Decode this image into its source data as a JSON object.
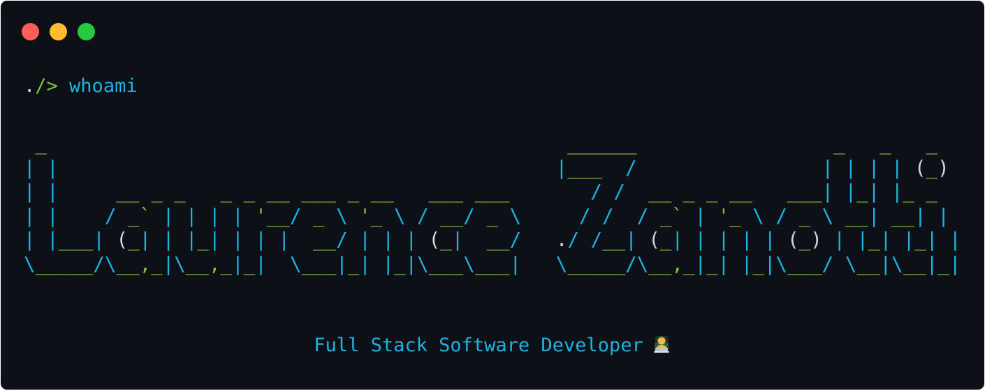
{
  "window": {
    "controls": [
      {
        "name": "close",
        "color": "#fe5f57"
      },
      {
        "name": "minimize",
        "color": "#febc2e"
      },
      {
        "name": "maximize",
        "color": "#28c840"
      }
    ]
  },
  "prompt": {
    "dot": ".",
    "arrow": "/>",
    "command": "whoami"
  },
  "banner": {
    "lines": [
      " _                                             ______                 _   _   _ ",
      "| |                                           |___  /                | | | | (_)",
      "| |     __ _ _   _ _ __ ___ _ __   ___ ___       / /  __ _ _ __   ___| |_| |_ _ ",
      "| |    / _` | | | | '__/ _ \\ '_ \\ / __/ _ \\     / /  / _` | '_ \\ / _ \\ __| __| |",
      "| |___| (_| | |_| | | |  __/ | | | (_|  __/   ./ /__| (_| | | | | (_) | |_| |_| |",
      "\\_____/\\__,_|\\__,_|_|  \\___|_| |_|\\___\\___|   \\_____/\\__,_|_| |_|\\___/ \\__|\\__|_|"
    ],
    "text": "Laurence Zanotti"
  },
  "subtitle": {
    "text": "Full Stack Software Developer",
    "emoji_icon": "technologist-emoji"
  },
  "colors": {
    "background": "#0d1117",
    "green": "#7cc243",
    "cyan": "#1cb3e0",
    "white": "#d0d7de"
  }
}
